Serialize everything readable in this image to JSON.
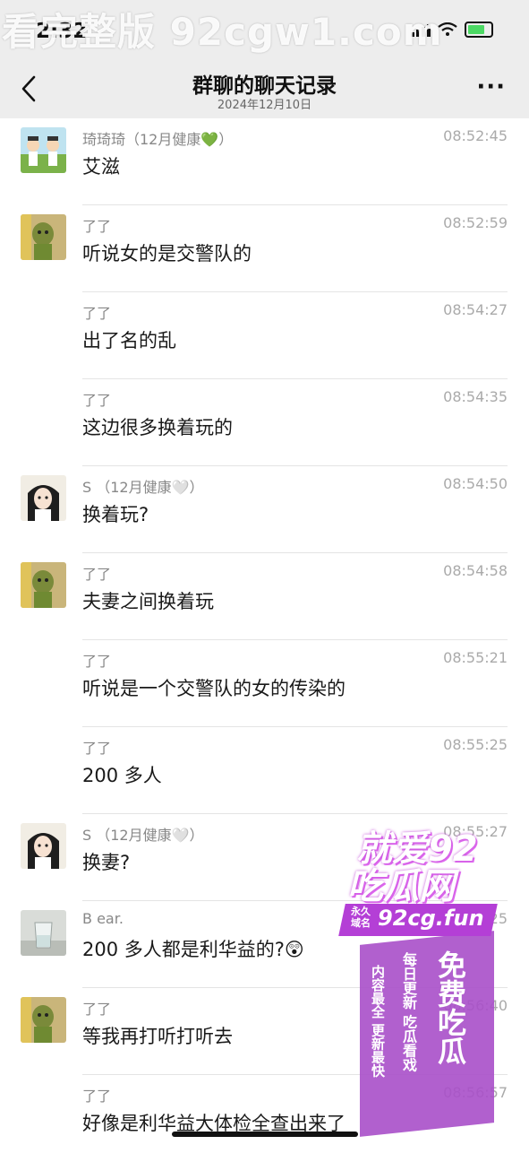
{
  "status_bar": {
    "time": "2:32",
    "location_glyph": "↗"
  },
  "watermark_top": "看完整版 92cgw1.com",
  "header": {
    "title": "群聊的聊天记录",
    "date": "2024年12月10日",
    "more_label": "···"
  },
  "messages": [
    {
      "sender": "琦琦琦（12月健康💚）",
      "time": "08:52:45",
      "text": "艾滋",
      "avatar": "avatar-cartoon"
    },
    {
      "sender": "了了",
      "time": "08:52:59",
      "text": "听说女的是交警队的",
      "avatar": "avatar-dog"
    },
    {
      "sender": "了了",
      "time": "08:54:27",
      "text": "出了名的乱",
      "avatar": ""
    },
    {
      "sender": "了了",
      "time": "08:54:35",
      "text": "这边很多换着玩的",
      "avatar": ""
    },
    {
      "sender": "S （12月健康🤍）",
      "time": "08:54:50",
      "text": "换着玩?",
      "avatar": "avatar-girl"
    },
    {
      "sender": "了了",
      "time": "08:54:58",
      "text": "夫妻之间换着玩",
      "avatar": "avatar-dog"
    },
    {
      "sender": "了了",
      "time": "08:55:21",
      "text": "听说是一个交警队的女的传染的",
      "avatar": ""
    },
    {
      "sender": "了了",
      "time": "08:55:25",
      "text": "200 多人",
      "avatar": ""
    },
    {
      "sender": "S （12月健康🤍）",
      "time": "08:55:27",
      "text": "换妻?",
      "avatar": "avatar-girl"
    },
    {
      "sender": "B ear.",
      "time": "08:56:25",
      "text": "200 多人都是利华益的?😲",
      "avatar": "avatar-glass"
    },
    {
      "sender": "了了",
      "time": "08:56:40",
      "text": "等我再打听打听去",
      "avatar": "avatar-dog"
    },
    {
      "sender": "了了",
      "time": "08:56:57",
      "text": "好像是利华益大体检全查出来了",
      "avatar": ""
    }
  ],
  "promo": {
    "line1": "就爱92",
    "line2": "吃瓜网",
    "domain_label": "永久域名",
    "domain": "92cg.fun",
    "vertical_big": "免费吃瓜",
    "vertical_mid": "每日更新 吃瓜看戏",
    "vertical_small": "内容最全 更新最快"
  }
}
